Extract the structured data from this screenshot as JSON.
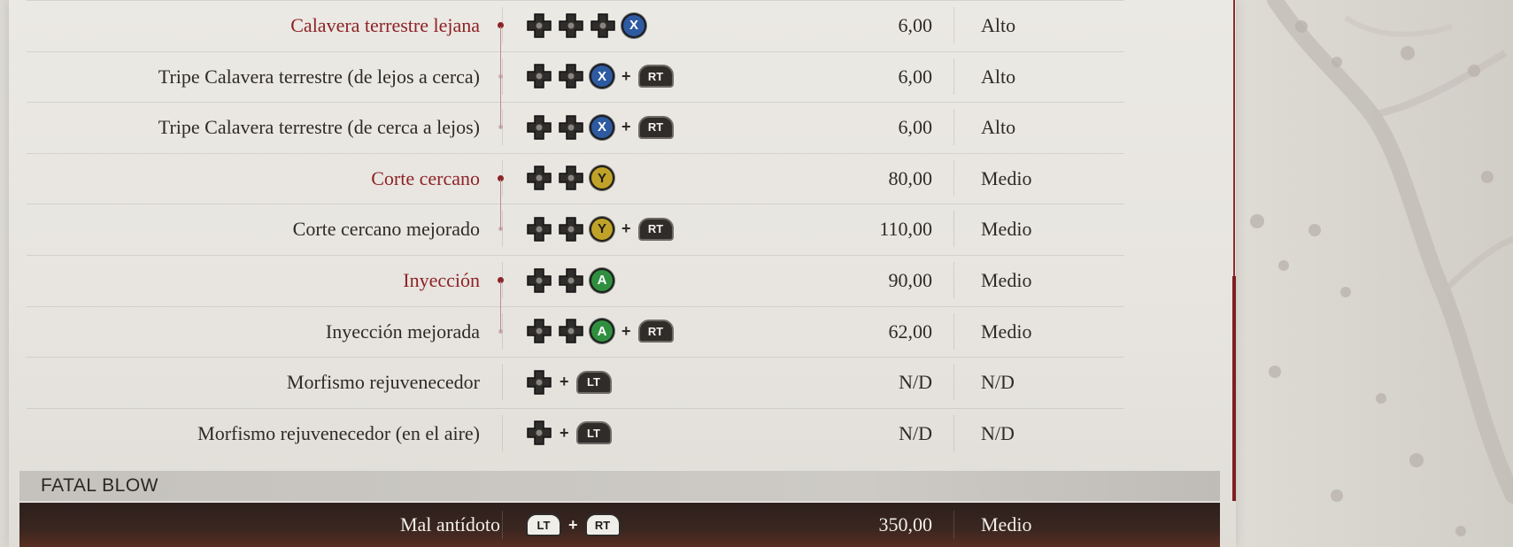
{
  "moves": [
    {
      "name": "Calavera terrestre lejana",
      "type": "parent",
      "inputs": [
        "dpad",
        "dpad",
        "dpad",
        "X"
      ],
      "damage": "6,00",
      "block": "Alto"
    },
    {
      "name": "Tripe Calavera terrestre (de lejos a cerca)",
      "type": "child",
      "inputs": [
        "dpad",
        "dpad",
        "X",
        "+",
        "RT"
      ],
      "damage": "6,00",
      "block": "Alto"
    },
    {
      "name": "Tripe Calavera terrestre (de cerca a lejos)",
      "type": "child",
      "inputs": [
        "dpad",
        "dpad",
        "X",
        "+",
        "RT"
      ],
      "damage": "6,00",
      "block": "Alto"
    },
    {
      "name": "Corte cercano",
      "type": "parent",
      "inputs": [
        "dpad",
        "dpad",
        "Y"
      ],
      "damage": "80,00",
      "block": "Medio"
    },
    {
      "name": "Corte cercano mejorado",
      "type": "child",
      "inputs": [
        "dpad",
        "dpad",
        "Y",
        "+",
        "RT"
      ],
      "damage": "110,00",
      "block": "Medio"
    },
    {
      "name": "Inyección",
      "type": "parent",
      "inputs": [
        "dpad",
        "dpad",
        "A"
      ],
      "damage": "90,00",
      "block": "Medio"
    },
    {
      "name": "Inyección mejorada",
      "type": "child",
      "inputs": [
        "dpad",
        "dpad",
        "A",
        "+",
        "RT"
      ],
      "damage": "62,00",
      "block": "Medio"
    },
    {
      "name": "Morfismo rejuvenecedor",
      "type": "plain",
      "inputs": [
        "dpad",
        "+",
        "LT"
      ],
      "damage": "N/D",
      "block": "N/D"
    },
    {
      "name": "Morfismo rejuvenecedor (en el aire)",
      "type": "plain",
      "inputs": [
        "dpad",
        "+",
        "LT"
      ],
      "damage": "N/D",
      "block": "N/D"
    }
  ],
  "fatal_section": {
    "title": "FATAL BLOW",
    "move": {
      "name": "Mal antídoto",
      "inputs": [
        "LT",
        "+",
        "RT"
      ],
      "damage": "350,00",
      "block": "Medio"
    }
  },
  "icons": {
    "dpad": "dpad-icon",
    "X": "x-button-icon",
    "Y": "y-button-icon",
    "A": "a-button-icon",
    "RT": "rt-trigger-icon",
    "LT": "lt-trigger-icon"
  },
  "colors": {
    "accent": "#8d2226",
    "text": "#2e2a27",
    "panel": "#e9e7e2",
    "fatal_bar": "#3a2620"
  }
}
